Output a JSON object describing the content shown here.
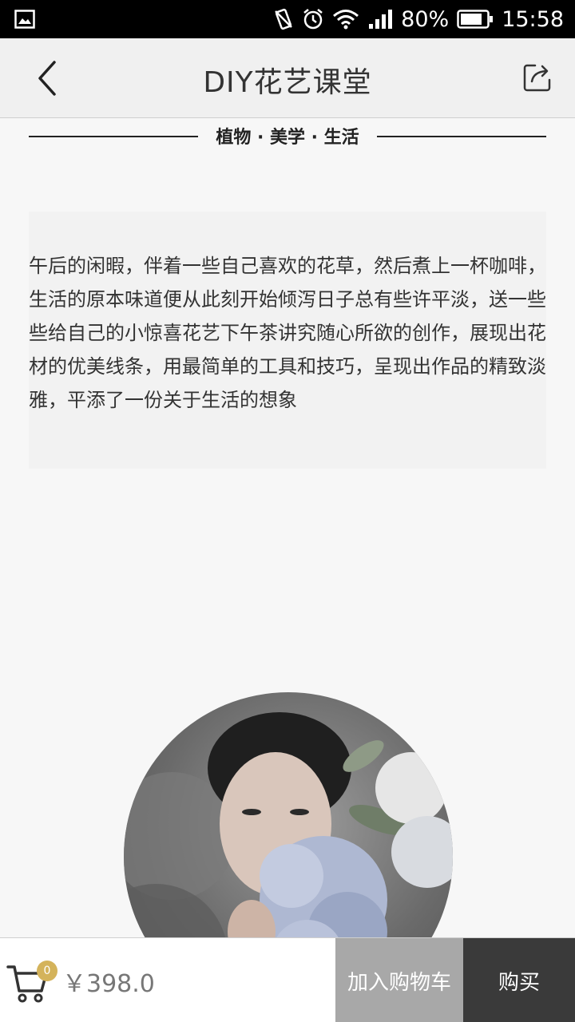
{
  "status_bar": {
    "battery": "80%",
    "time": "15:58",
    "icons": [
      "image-icon",
      "vibrate-icon",
      "alarm-icon",
      "wifi-icon",
      "signal-icon",
      "battery-icon"
    ]
  },
  "header": {
    "title": "DIY花艺课堂",
    "back_icon": "chevron-left-icon",
    "share_icon": "share-icon"
  },
  "tagline": "植物 · 美学 · 生活",
  "description": "午后的闲暇，伴着一些自己喜欢的花草，然后煮上一杯咖啡，生活的原本味道便从此刻开始倾泻日子总有些许平淡，送一些些给自己的小惊喜花艺下午茶讲究随心所欲的创作，展现出花材的优美线条，用最简单的工具和技巧，呈现出作品的精致淡雅，平添了一份关于生活的想象",
  "avatar": {
    "description_icon": "avatar-icon"
  },
  "bottom_bar": {
    "cart_count": "0",
    "price": "￥398.0",
    "add_to_cart_label": "加入购物车",
    "buy_label": "购买"
  },
  "colors": {
    "badge": "#d4b35b",
    "add_cart_bg": "#a8a8a8",
    "buy_bg": "#3a3a3a"
  }
}
